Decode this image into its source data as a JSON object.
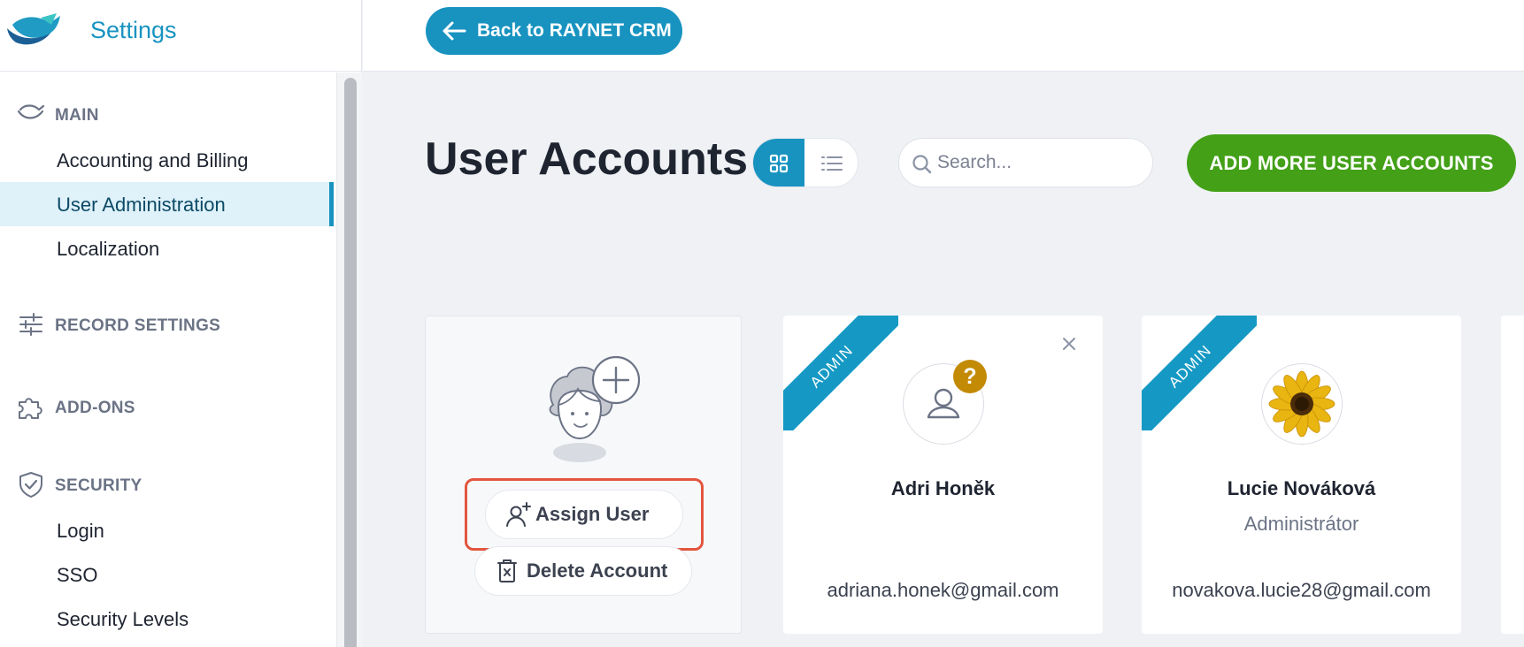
{
  "app": {
    "title": "Settings"
  },
  "topbar": {
    "back_label": "Back to RAYNET CRM"
  },
  "sidebar": {
    "sections": [
      {
        "label": "MAIN",
        "icon": "raynet-logo-icon",
        "items": [
          "Accounting and Billing",
          "User Administration",
          "Localization"
        ],
        "active": "User Administration"
      },
      {
        "label": "RECORD SETTINGS",
        "icon": "sliders-icon",
        "items": []
      },
      {
        "label": "ADD-ONS",
        "icon": "puzzle-icon",
        "items": []
      },
      {
        "label": "SECURITY",
        "icon": "shield-check-icon",
        "items": [
          "Login",
          "SSO",
          "Security Levels"
        ]
      }
    ]
  },
  "page": {
    "title": "User Accounts",
    "view_modes": [
      "grid",
      "list"
    ],
    "active_view": "grid",
    "search_placeholder": "Search...",
    "add_button": "ADD MORE USER ACCOUNTS"
  },
  "cards": [
    {
      "type": "empty",
      "assign_label": "Assign User",
      "delete_label": "Delete Account"
    },
    {
      "type": "user",
      "badge": "ADMIN",
      "name": "Adri Honěk",
      "role": "",
      "email": "adriana.honek@gmail.com",
      "avatar": "placeholder",
      "status_badge": "?"
    },
    {
      "type": "user",
      "badge": "ADMIN",
      "name": "Lucie Nováková",
      "role": "Administrátor",
      "email": "novakova.lucie28@gmail.com",
      "avatar": "sunflower"
    }
  ],
  "colors": {
    "accent": "#1893c0",
    "primary_green": "#43a017",
    "highlight": "#e3553f",
    "warning": "#c38a05"
  }
}
